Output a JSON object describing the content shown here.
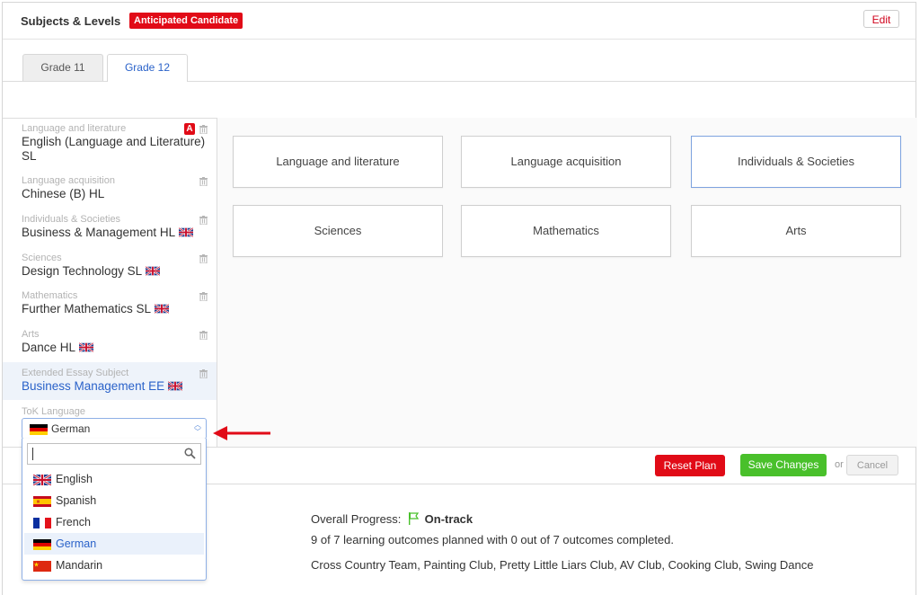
{
  "header": {
    "title": "Subjects & Levels",
    "badge": "Anticipated Candidate",
    "edit_label": "Edit"
  },
  "tabs": [
    {
      "label": "Grade 11",
      "active": false
    },
    {
      "label": "Grade 12",
      "active": true
    }
  ],
  "subjects": [
    {
      "category": "Language and literature",
      "name": "English (Language and Literature) SL",
      "uk_flag": false,
      "a_badge": "A",
      "active": false
    },
    {
      "category": "Language acquisition",
      "name": "Chinese (B) HL",
      "uk_flag": false,
      "active": false
    },
    {
      "category": "Individuals & Societies",
      "name": "Business & Management HL",
      "uk_flag": true,
      "active": false
    },
    {
      "category": "Sciences",
      "name": "Design Technology SL",
      "uk_flag": true,
      "active": false
    },
    {
      "category": "Mathematics",
      "name": "Further Mathematics SL",
      "uk_flag": true,
      "active": false
    },
    {
      "category": "Arts",
      "name": "Dance HL",
      "uk_flag": true,
      "active": false
    },
    {
      "category": "Extended Essay Subject",
      "name": "Business Management EE",
      "uk_flag": true,
      "active": true
    }
  ],
  "tok": {
    "label": "ToK Language",
    "selected": "German",
    "search_value": "",
    "options": [
      {
        "label": "English",
        "flag": "uk-flag-icon",
        "highlighted": false
      },
      {
        "label": "Spanish",
        "flag": "spain-flag-icon",
        "highlighted": false
      },
      {
        "label": "French",
        "flag": "france-flag-icon",
        "highlighted": false
      },
      {
        "label": "German",
        "flag": "germany-flag-icon",
        "highlighted": true
      },
      {
        "label": "Mandarin",
        "flag": "china-flag-icon",
        "highlighted": false
      }
    ]
  },
  "categories": [
    {
      "label": "Language and literature",
      "selected": false
    },
    {
      "label": "Language acquisition",
      "selected": false
    },
    {
      "label": "Individuals & Societies",
      "selected": true
    },
    {
      "label": "Sciences",
      "selected": false
    },
    {
      "label": "Mathematics",
      "selected": false
    },
    {
      "label": "Arts",
      "selected": false
    }
  ],
  "actions": {
    "reset_label": "Reset Plan",
    "save_label": "Save Changes",
    "or_text": "or",
    "cancel_label": "Cancel"
  },
  "progress": {
    "label": "Overall Progress:",
    "status": "On-track",
    "outcomes_text": "9 of 7 learning outcomes planned with 0 out of 7 outcomes completed.",
    "activities_text": "Cross Country Team, Painting Club, Pretty Little Liars Club, AV Club, Cooking Club, Swing Dance"
  },
  "colors": {
    "accent_blue": "#2a62c9",
    "danger_red": "#e10b17",
    "success_green": "#49c02b"
  }
}
